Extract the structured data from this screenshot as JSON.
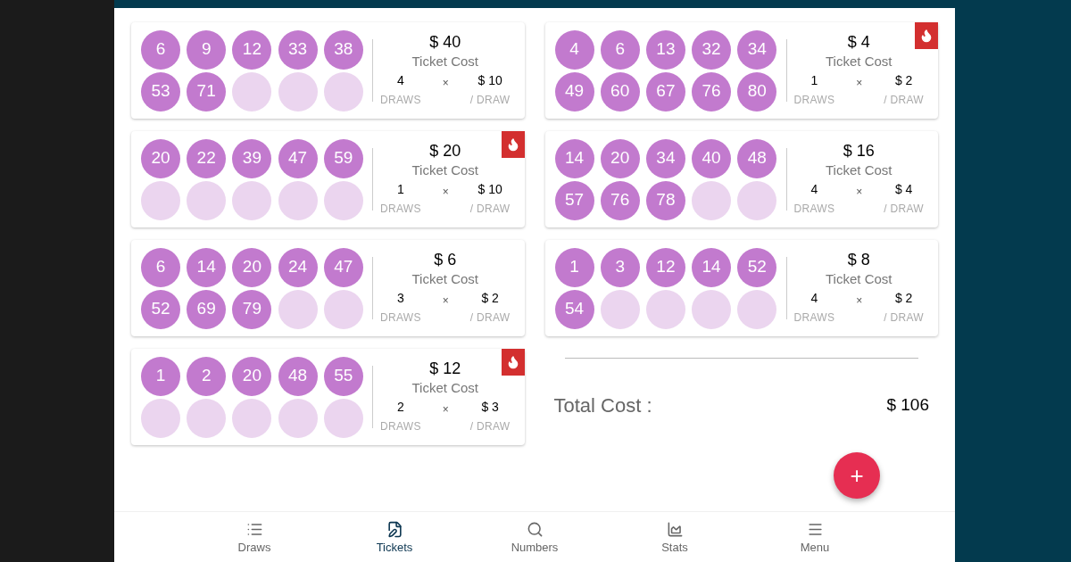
{
  "tickets_left": [
    {
      "numbers": [
        "6",
        "9",
        "12",
        "33",
        "38",
        "53",
        "71"
      ],
      "cost": "$ 40",
      "cost_label": "Ticket Cost",
      "draws": "4",
      "times": "×",
      "per_draw": "$ 10",
      "draws_label": "DRAWS",
      "per_draw_label": "/ DRAW",
      "hot": false
    },
    {
      "numbers": [
        "20",
        "22",
        "39",
        "47",
        "59"
      ],
      "cost": "$ 20",
      "cost_label": "Ticket Cost",
      "draws": "1",
      "times": "×",
      "per_draw": "$ 10",
      "draws_label": "DRAWS",
      "per_draw_label": "/ DRAW",
      "hot": true
    },
    {
      "numbers": [
        "6",
        "14",
        "20",
        "24",
        "47",
        "52",
        "69",
        "79"
      ],
      "cost": "$ 6",
      "cost_label": "Ticket Cost",
      "draws": "3",
      "times": "×",
      "per_draw": "$ 2",
      "draws_label": "DRAWS",
      "per_draw_label": "/ DRAW",
      "hot": false
    },
    {
      "numbers": [
        "1",
        "2",
        "20",
        "48",
        "55"
      ],
      "cost": "$ 12",
      "cost_label": "Ticket Cost",
      "draws": "2",
      "times": "×",
      "per_draw": "$ 3",
      "draws_label": "DRAWS",
      "per_draw_label": "/ DRAW",
      "hot": true
    }
  ],
  "tickets_right": [
    {
      "numbers": [
        "4",
        "6",
        "13",
        "32",
        "34",
        "49",
        "60",
        "67",
        "76",
        "80"
      ],
      "cost": "$ 4",
      "cost_label": "Ticket Cost",
      "draws": "1",
      "times": "×",
      "per_draw": "$ 2",
      "draws_label": "DRAWS",
      "per_draw_label": "/ DRAW",
      "hot": true
    },
    {
      "numbers": [
        "14",
        "20",
        "34",
        "40",
        "48",
        "57",
        "76",
        "78"
      ],
      "cost": "$ 16",
      "cost_label": "Ticket Cost",
      "draws": "4",
      "times": "×",
      "per_draw": "$ 4",
      "draws_label": "DRAWS",
      "per_draw_label": "/ DRAW",
      "hot": false
    },
    {
      "numbers": [
        "1",
        "3",
        "12",
        "14",
        "52",
        "54"
      ],
      "cost": "$ 8",
      "cost_label": "Ticket Cost",
      "draws": "4",
      "times": "×",
      "per_draw": "$ 2",
      "draws_label": "DRAWS",
      "per_draw_label": "/ DRAW",
      "hot": false
    }
  ],
  "total": {
    "label": "Total Cost :",
    "value": "$ 106"
  },
  "fab": {
    "label": "+"
  },
  "nav": [
    {
      "kind": "draws",
      "label": "Draws",
      "selected": false
    },
    {
      "kind": "tickets",
      "label": "Tickets",
      "selected": true
    },
    {
      "kind": "numbers",
      "label": "Numbers",
      "selected": false
    },
    {
      "kind": "stats",
      "label": "Stats",
      "selected": false
    },
    {
      "kind": "menu",
      "label": "Menu",
      "selected": false
    }
  ]
}
